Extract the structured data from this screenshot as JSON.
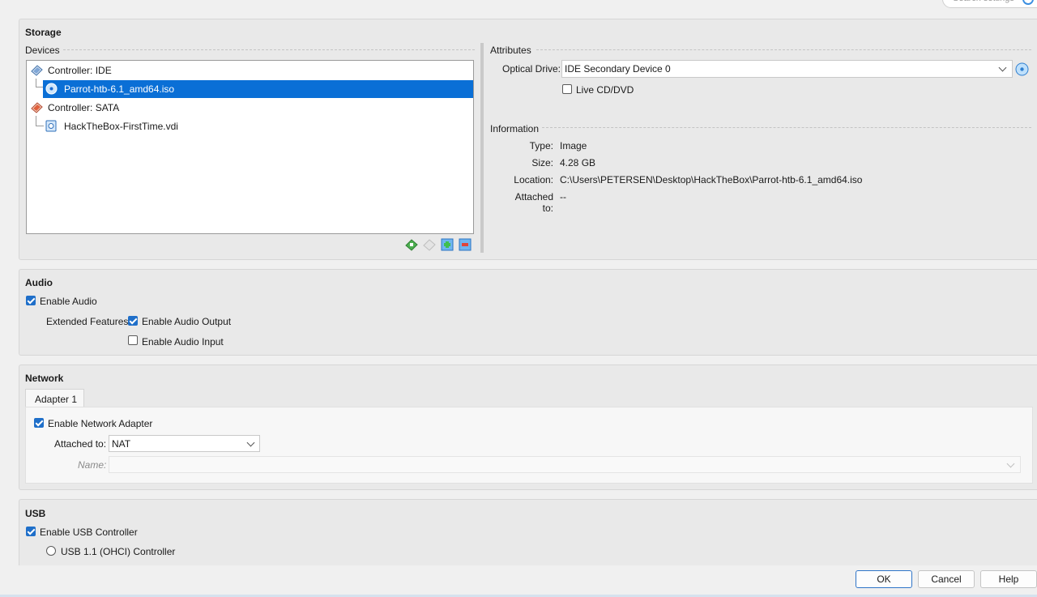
{
  "search": {
    "placeholder": "Search settings"
  },
  "storage": {
    "title": "Storage",
    "devices_label": "Devices",
    "tree": [
      {
        "label": "Controller: IDE",
        "kind": "controller"
      },
      {
        "label": "Parrot-htb-6.1_amd64.iso",
        "kind": "optical",
        "selected": true
      },
      {
        "label": "Controller: SATA",
        "kind": "controller"
      },
      {
        "label": "HackTheBox-FirstTime.vdi",
        "kind": "disk"
      }
    ],
    "attributes_label": "Attributes",
    "optical_drive_label": "Optical Drive:",
    "optical_drive_value": "IDE Secondary Device 0",
    "live_cd_label": "Live CD/DVD",
    "live_cd_checked": false,
    "information_label": "Information",
    "info": {
      "type_label": "Type:",
      "type_value": "Image",
      "size_label": "Size:",
      "size_value": "4.28 GB",
      "location_label": "Location:",
      "location_value": "C:\\Users\\PETERSEN\\Desktop\\HackTheBox\\Parrot-htb-6.1_amd64.iso",
      "attached_label": "Attached to:",
      "attached_value": "--"
    }
  },
  "audio": {
    "title": "Audio",
    "enable_label": "Enable Audio",
    "enable_checked": true,
    "extended_label": "Extended Features:",
    "output_label": "Enable Audio Output",
    "output_checked": true,
    "input_label": "Enable Audio Input",
    "input_checked": false
  },
  "network": {
    "title": "Network",
    "tab_label": "Adapter 1",
    "enable_label": "Enable Network Adapter",
    "enable_checked": true,
    "attached_label": "Attached to:",
    "attached_value": "NAT",
    "name_label": "Name:",
    "name_value": ""
  },
  "usb": {
    "title": "USB",
    "enable_label": "Enable USB Controller",
    "enable_checked": true,
    "usb11_label": "USB 1.1 (OHCI) Controller"
  },
  "buttons": {
    "ok": "OK",
    "cancel": "Cancel",
    "help": "Help"
  },
  "colors": {
    "selection": "#0a6fd6",
    "accent": "#1f6fc9",
    "panel": "#e9e9e9"
  }
}
